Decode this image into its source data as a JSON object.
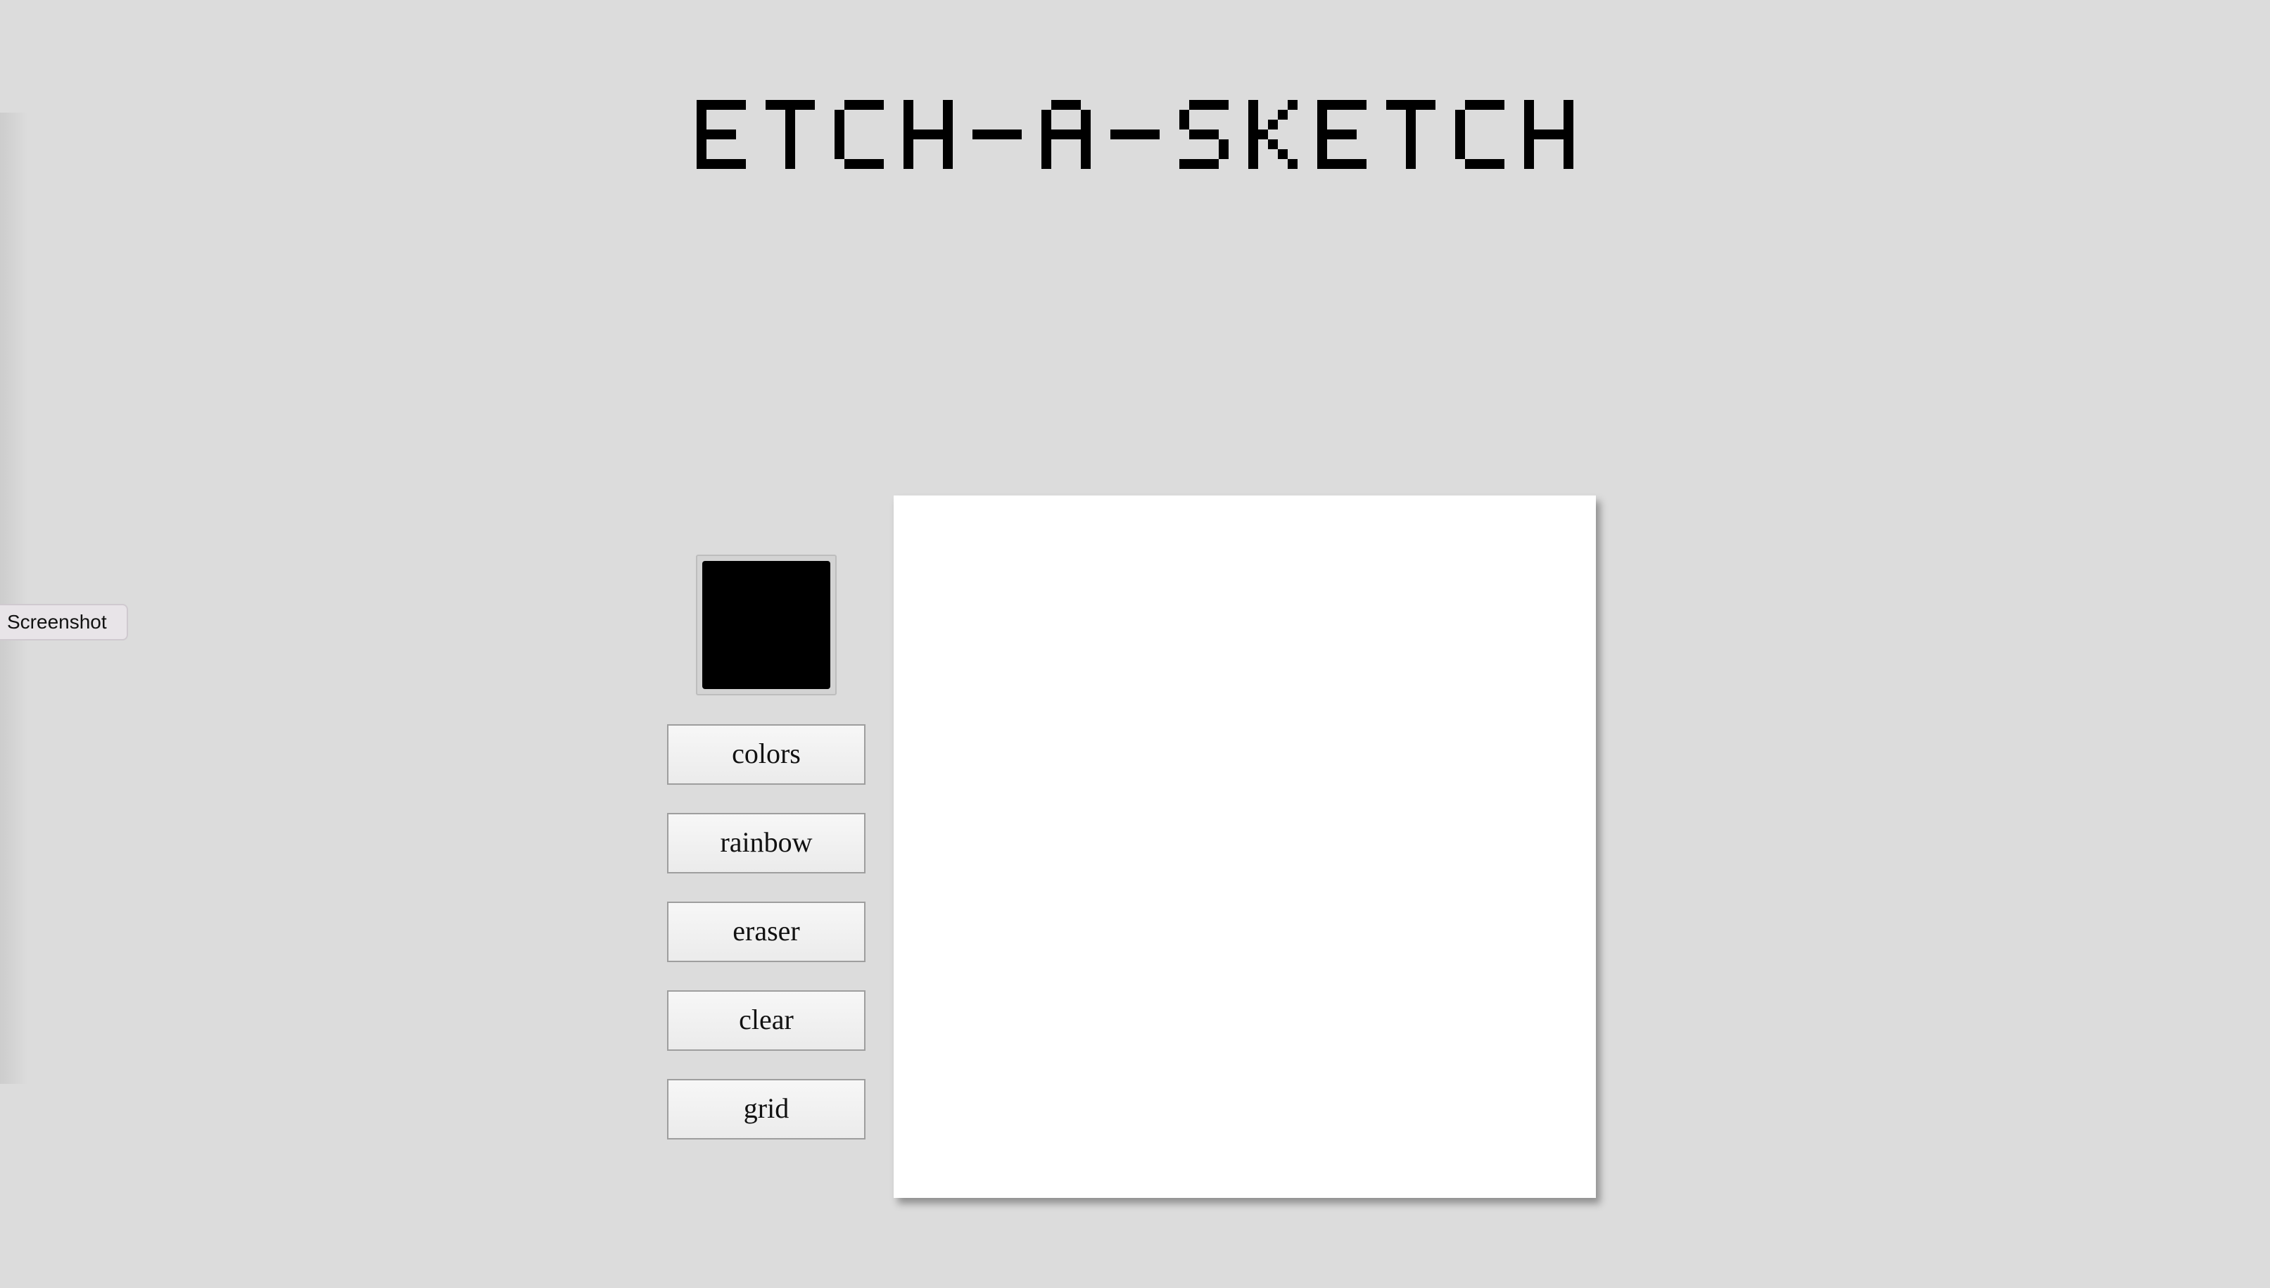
{
  "title": "ETCH-A-SKETCH",
  "screenshot_tab": {
    "label": "Screenshot"
  },
  "color_picker": {
    "value": "#000000"
  },
  "buttons": {
    "colors": "colors",
    "rainbow": "rainbow",
    "eraser": "eraser",
    "clear": "clear",
    "grid": "grid"
  },
  "canvas": {
    "background": "#ffffff"
  },
  "page": {
    "background": "#dcdcdc"
  }
}
